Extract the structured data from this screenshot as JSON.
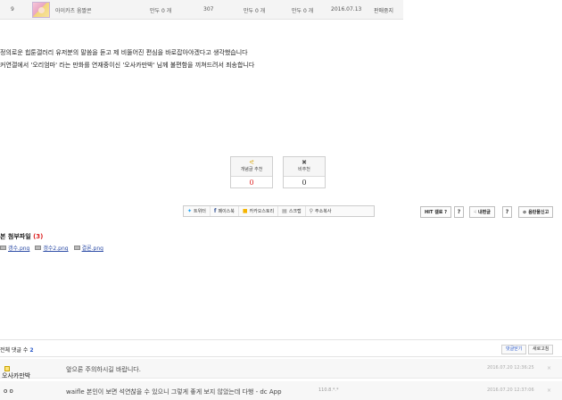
{
  "post_row": {
    "number": "9",
    "author": "아이카츠 움짤콘",
    "votes": "만두 0 개",
    "views": "307",
    "col5": "만두 0 개",
    "col6": "만두 0 개",
    "date": "2016.07.13",
    "status": "판매중지"
  },
  "body": {
    "line1": "정의로운 힙툰갤러리 유저분의 말씀을 듣고 제 비뚤어진 편심을 바로잡아야겠다고 생각했습니다",
    "line2": "커연갤에서 '오리엄마' 라는 만화를 연재중이신 '오사카만박' 님께 불편함을 끼쳐드려서 죄송합니다"
  },
  "votes": {
    "up": {
      "icon": "ᕙ",
      "label": "개념글 추천",
      "count": "0"
    },
    "down": {
      "icon": "✖",
      "label": "비추천",
      "count": "0"
    }
  },
  "share": {
    "twitter": "트위터",
    "facebook": "페이스북",
    "kakaostory": "카카오스토리",
    "scrap": "스크랩",
    "copy_url": "주소복사"
  },
  "actions": {
    "hit": "HIT 갤로 ?",
    "q1": "?",
    "recommend": "내편글",
    "q2": "?",
    "report": "음란물신고"
  },
  "attachments": {
    "title": "본 첨부파일",
    "count": "(3)",
    "files": [
      "갱수.png",
      "갱수2.png",
      "결론.png"
    ]
  },
  "comments": {
    "label": "전체 댓글 수",
    "count": "2",
    "open_label": "댓글닫기",
    "refresh_label": "새로고침",
    "items": [
      {
        "author": "오사카만박",
        "text": "앞으론 주의하시길 바랍니다.",
        "ip": "",
        "date": "2016.07.20 12:36:25",
        "del": "×"
      },
      {
        "author": "o o",
        "text": "waifle 본인이 보면 석연찮을 수 있으니 그렇게 좋게 보지 않았는데 다행 - dc App",
        "ip": "110.8.*.*",
        "date": "2016.07.20 12:37:06",
        "del": "×"
      }
    ]
  }
}
